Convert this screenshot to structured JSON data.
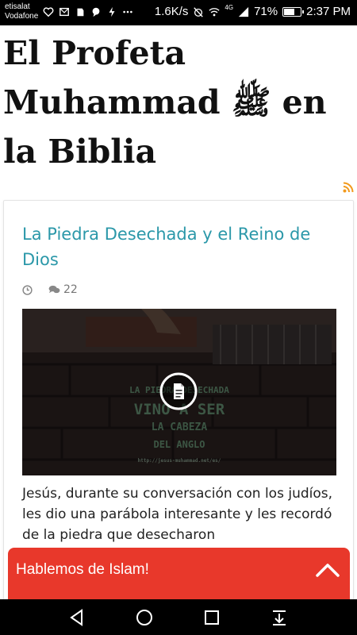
{
  "status_bar": {
    "carrier_line1": "etisalat",
    "carrier_line2": "Vodafone",
    "speed": "1.6K/s",
    "network": "4G",
    "battery_percent": "71%",
    "battery_level": 0.71,
    "time": "2:37 PM",
    "icons": [
      "heart-icon",
      "mail-icon",
      "evernote-icon",
      "chat-icon",
      "bolt-icon",
      "more-icon",
      "alarm-off-icon",
      "wifi-icon",
      "signal-icon",
      "battery-icon"
    ]
  },
  "site": {
    "title": "El Profeta Muhammad ﷺ en la Biblia"
  },
  "post": {
    "title": "La Piedra Desechada y el Reino de Dios",
    "comment_count": "22",
    "thumbnail": {
      "text_top": "LA PIEDRA DESECHADA",
      "text_mid": "VINO A SER",
      "text_low": "LA CABEZA",
      "text_bottom": "DEL ANGLO",
      "url_text": "http://jesus-muhammad.net/es/"
    },
    "excerpt": "Jesús, durante su conversación con los judíos, les dio una parábola interesante y les recordó de la piedra que desecharon"
  },
  "chat": {
    "label": "Hablemos de Islam!"
  },
  "colors": {
    "link": "#2b98a9",
    "chat_bar": "#e8382b",
    "rss": "#f29a1d"
  }
}
